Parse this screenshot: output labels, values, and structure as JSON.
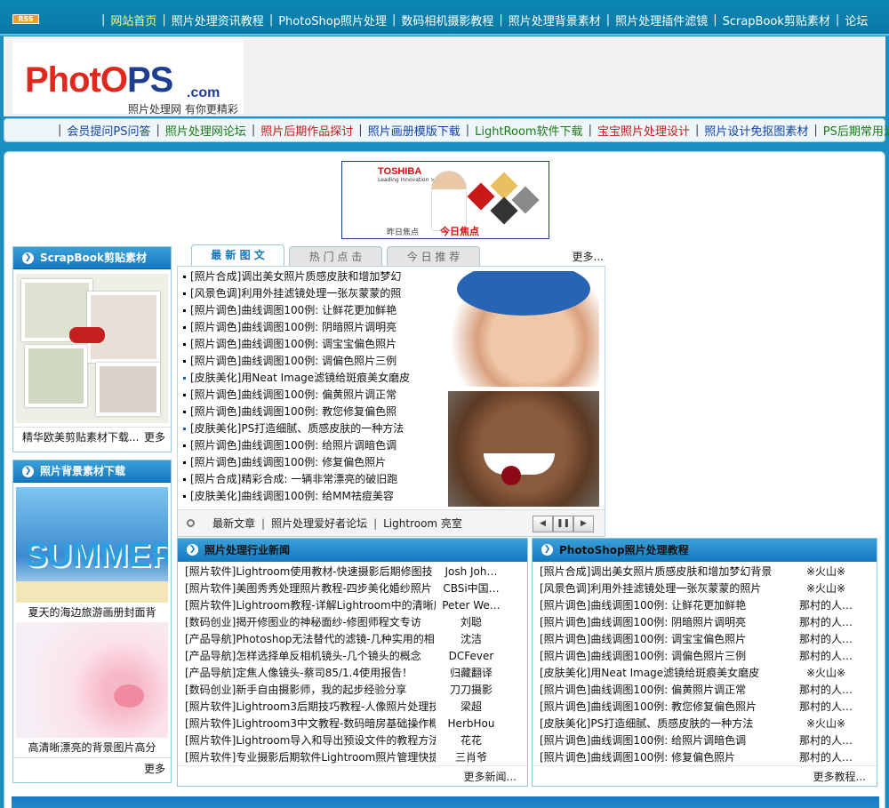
{
  "topbar": {
    "rss_label": "RSS",
    "nav": [
      {
        "label": "网站首页",
        "active": true
      },
      {
        "label": "照片处理资讯教程"
      },
      {
        "label": "PhotoShop照片处理"
      },
      {
        "label": "数码相机摄影教程"
      },
      {
        "label": "照片处理背景素材"
      },
      {
        "label": "照片处理插件滤镜"
      },
      {
        "label": "ScrapBook剪贴素材"
      },
      {
        "label": "论坛"
      }
    ]
  },
  "header": {
    "logo_r1": "Phot",
    "logo_r2": "O",
    "logo_b": "PS",
    "logo_com": ".com",
    "slogan": "照片处理网 有你更精彩"
  },
  "subnav": [
    {
      "label": "会员提问PS问答",
      "color": "blue"
    },
    {
      "label": "照片处理网论坛",
      "color": "green"
    },
    {
      "label": "照片后期作品探讨",
      "color": "red"
    },
    {
      "label": "照片画册模版下载",
      "color": "blue"
    },
    {
      "label": "LightRoom软件下载",
      "color": "green"
    },
    {
      "label": "宝宝照片处理设计",
      "color": "red"
    },
    {
      "label": "照片设计免抠图素材",
      "color": "blue"
    },
    {
      "label": "PS后期常用滤镜",
      "color": "green"
    }
  ],
  "ad": {
    "brand": "TOSHIBA",
    "sub": "Leading Innovation >>>",
    "foot": "昨日焦点",
    "tag": "今日焦点"
  },
  "left": {
    "scrap_title": "ScrapBook剪贴素材",
    "scrap_caption": "精华欧美剪贴素材下载...",
    "more": "更多",
    "bg_title": "照片背景素材下载",
    "bg_caption1": "夏天的海边旅游画册封面背",
    "bg_caption2": "高清晰漂亮的背景图片高分",
    "bg_more": "更多"
  },
  "tabs": {
    "items": [
      "最 新 图 文",
      "热 门 点 击",
      "今 日 推 荐"
    ],
    "more": "更多..."
  },
  "tablist": [
    "[照片合成]调出美女照片质感皮肤和增加梦幻",
    "[风景色调]利用外挂滤镜处理一张灰蒙蒙的照",
    "[照片调色]曲线调图100例: 让鲜花更加鲜艳",
    "[照片调色]曲线调图100例: 阴暗照片调明亮",
    "[照片调色]曲线调图100例: 调宝宝偏色照片",
    "[照片调色]曲线调图100例: 调偏色照片三例",
    "[皮肤美化]用Neat Image滤镜给斑痕美女磨皮",
    "[照片调色]曲线调图100例: 偏黄照片调正常",
    "[照片调色]曲线调图100例: 教您修复偏色照",
    "[皮肤美化]PS打造细腻、质感皮肤的一种方法",
    "[照片调色]曲线调图100例: 给照片调暗色调",
    "[照片调色]曲线调图100例: 修复偏色照片",
    "[照片合成]精彩合成: 一辆非常漂亮的破旧跑",
    "[皮肤美化]曲线调图100例: 给MM祛痘美容"
  ],
  "tabfoot": {
    "items": [
      "最新文章",
      "照片处理爱好者论坛",
      "Lightroom 亮室"
    ],
    "prev": "◀",
    "pause": "❚❚",
    "next": "▶"
  },
  "news_left": {
    "title": "照片处理行业新闻",
    "more": "更多新闻...",
    "rows": [
      {
        "t": "[照片软件]Lightroom使用教材-快速摄影后期修图技",
        "a": "Josh Joh…"
      },
      {
        "t": "[照片软件]美图秀秀处理照片教程-四步美化婚纱照片",
        "a": "CBSi中国…"
      },
      {
        "t": "[照片软件]Lightroom教程-详解Lightroom中的清晰度",
        "a": "Peter We…"
      },
      {
        "t": "[数码创业]揭开修图业的神秘面纱-修图师程文专访",
        "a": "刘聪"
      },
      {
        "t": "[产品导航]Photoshop无法替代的滤镜-几种实用的相",
        "a": "沈洁"
      },
      {
        "t": "[产品导航]怎样选择单反相机镜头-几个镜头的概念",
        "a": "DCFever"
      },
      {
        "t": "[产品导航]定焦人像镜头-蔡司85/1.4使用报告！",
        "a": "归藏翻译"
      },
      {
        "t": "[数码创业]新手自由摄影师，我的起步经验分享",
        "a": "刀刀摄影"
      },
      {
        "t": "[照片软件]Lightroom3后期技巧教程-人像照片处理技",
        "a": "梁超"
      },
      {
        "t": "[照片软件]Lightroom3中文教程-数码暗房基础操作概",
        "a": "HerbHou"
      },
      {
        "t": "[照片软件]Lightroom导入和导出预设文件的教程方法",
        "a": "花花"
      },
      {
        "t": "[照片软件]专业摄影后期软件Lightroom照片管理快捷",
        "a": "三肖爷"
      }
    ]
  },
  "news_right": {
    "title": "PhotoShop照片处理教程",
    "more": "更多教程...",
    "rows": [
      {
        "t": "[照片合成]调出美女照片质感皮肤和增加梦幻背景",
        "a": "※火山※"
      },
      {
        "t": "[风景色调]利用外挂滤镜处理一张灰蒙蒙的照片",
        "a": "※火山※"
      },
      {
        "t": "[照片调色]曲线调图100例: 让鲜花更加鲜艳",
        "a": "那村的人…"
      },
      {
        "t": "[照片调色]曲线调图100例: 阴暗照片调明亮",
        "a": "那村的人…"
      },
      {
        "t": "[照片调色]曲线调图100例: 调宝宝偏色照片",
        "a": "那村的人…"
      },
      {
        "t": "[照片调色]曲线调图100例: 调偏色照片三例",
        "a": "那村的人…"
      },
      {
        "t": "[皮肤美化]用Neat Image滤镜给斑痕美女磨皮",
        "a": "※火山※"
      },
      {
        "t": "[照片调色]曲线调图100例: 偏黄照片调正常",
        "a": "那村的人…"
      },
      {
        "t": "[照片调色]曲线调图100例: 教您修复偏色照片",
        "a": "那村的人…"
      },
      {
        "t": "[皮肤美化]PS打造细腻、质感皮肤的一种方法",
        "a": "※火山※"
      },
      {
        "t": "[照片调色]曲线调图100例: 给照片调暗色调",
        "a": "那村的人…"
      },
      {
        "t": "[照片调色]曲线调图100例: 修复偏色照片",
        "a": "那村的人…"
      }
    ]
  }
}
